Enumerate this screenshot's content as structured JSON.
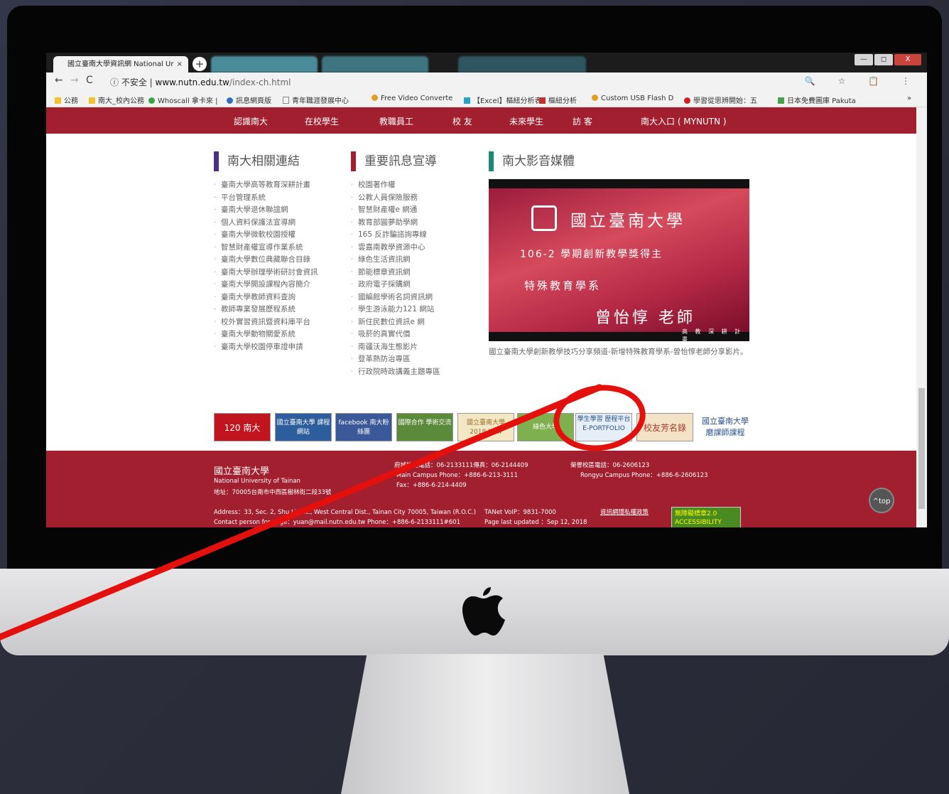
{
  "browser": {
    "active_tab_title": "國立臺南大學資訊網 National Ur",
    "tab_close": "×",
    "new_tab": "+",
    "url_security": "不安全",
    "url_host": "www.nutn.edu.tw",
    "url_path": "/index-ch.html",
    "window_controls": [
      "—",
      "◻",
      "X"
    ],
    "addr_right_icons": "🔍 ☆ 📋 ⋮",
    "bookmarks": [
      {
        "label": "公務",
        "color": "#f2c230"
      },
      {
        "label": "南大_校內公務",
        "color": "#f2c230"
      },
      {
        "label": "Whoscall 拿卡來 | ",
        "color": "#3da343"
      },
      {
        "label": "訊息網頁版",
        "color": "#2f6fc0"
      },
      {
        "label": "青年職涯發展中心",
        "color": "#888888"
      },
      {
        "label": "Free Video Converte",
        "color": "#e0a020"
      },
      {
        "label": "【Excel】樞紐分析表",
        "color": "#28a0c8"
      },
      {
        "label": "樞紐分析",
        "color": "#c03030"
      },
      {
        "label": "Custom USB Flash D",
        "color": "#e0a020"
      },
      {
        "label": "學習從思辨開始：五",
        "color": "#d02020"
      },
      {
        "label": "日本免費圖庫 Pakuta",
        "color": "#4aa04a"
      }
    ],
    "bookmarks_more": "»"
  },
  "nav": [
    "認識南大",
    "在校學生",
    "教職員工",
    "校 友",
    "未來學生",
    "訪 客",
    "南大入口 ( MYNUTN )"
  ],
  "sections": {
    "links_title": "南大相關連結",
    "links": [
      "臺南大學高等教育深耕計畫",
      "平台管理系統",
      "臺南大學退休聯誼網",
      "個人資料保護法宣導網",
      "臺南大學微軟校園授權",
      "智慧財產權宣導作業系統",
      "臺南大學數位典藏聯合目錄",
      "臺南大學辦理學術研討會資訊",
      "臺南大學開設課程內容簡介",
      "臺南大學教師資料查詢",
      "教師專業發展歷程系統",
      "校外實習資訊暨資料庫平台",
      "臺南大學動物關愛系統",
      "臺南大學校園停車證申請"
    ],
    "notice_title": "重要訊息宣導",
    "notices": [
      "校園著作權",
      "公教人員保險服務",
      "智慧財產權e 網通",
      "教育部圓夢助學網",
      "165 反詐騙諮詢專線",
      "雲嘉南教學資源中心",
      "綠色生活資訊網",
      "節能標章資訊網",
      "政府電子採購網",
      "國編館學術名詞資訊網",
      "學生游泳能力121 網站",
      "新住民數位資訊e 網",
      "吸菸的真實代價",
      "南疆沃海生態影片",
      "登革熱防治專區",
      "行政院時政講義主題專區"
    ],
    "media_title": "南大影音媒體",
    "video": {
      "uni": "國立臺南大學",
      "line1": "106-2 學期創新教學獎得主",
      "line2": "特殊教育學系",
      "line3": "曾怡惇  老師",
      "line4": "高 教 深 耕 計 畫"
    },
    "video_caption": "國立臺南大學創新教學技巧分享頻道-新增特殊教育學系-曾怡惇老師分享影片。"
  },
  "banners": [
    {
      "label": "120 南大",
      "bg": "#c0141f",
      "fg": "#ffffff"
    },
    {
      "label": "國立臺南大學 課程網站",
      "bg": "#2d5d9c",
      "fg": "#ffffff"
    },
    {
      "label": "facebook 南大粉絲團",
      "bg": "#3b5998",
      "fg": "#ffffff"
    },
    {
      "label": "國際合作 學術交流",
      "bg": "#5a8a3a",
      "fg": "#ffffff"
    },
    {
      "label": "國立臺南大學 2018 New",
      "bg": "#f3e7c4",
      "fg": "#9a6b2c"
    },
    {
      "label": "綠色大學",
      "bg": "#7fb04f",
      "fg": "#ffffff"
    },
    {
      "label": "學生學習 歷程平台 E-PORTFOLIO",
      "bg": "#e6eef7",
      "fg": "#2a4f8c"
    },
    {
      "label": "校友芳名錄",
      "bg": "#f4e2c6",
      "fg": "#a83a2a"
    },
    {
      "label": "國立臺南大學 磨課師課程",
      "bg": "#ffffff",
      "fg": "#2a4f8c"
    }
  ],
  "footer": {
    "name_zh": "國立臺南大學",
    "name_en": "National University of Tainan",
    "addr_zh": "地址：70005台南市中西區樹林街二段33號",
    "main_tel": "府城校區電話：06-2133111傳真：06-2144409",
    "main_phone_en": "Main Campus Phone：+886-6-213-3111",
    "fax_en": "Fax：+886-6-214-4409",
    "rongyu_tel": "榮譽校區電話：06-2606123",
    "rongyu_phone_en": "Rongyu Campus Phone：+886-6-2606123",
    "address_en": "Address：33, Sec. 2, Shu Lin St., West Central Dist., Tainan City 70005, Taiwan (R.O.C.)",
    "tanet": "TANet VoIP：9831-7000",
    "privacy": "資訊網隱私權政策",
    "contact": "Contact person for page：yuan@mail.nutn.edu.tw   Phone：+886-6-2133111#601",
    "updated": "Page last updated ：Sep 12, 2018",
    "accessibility": "無障礙標章2.0 ACCESSIBILITY",
    "top_button": "^top"
  },
  "colors": {
    "brand": "#a11f2e",
    "links_accent": "#4b2f8a",
    "notice_accent": "#a11f2e",
    "media_accent": "#1b8a73",
    "annotation": "#e4100e"
  }
}
